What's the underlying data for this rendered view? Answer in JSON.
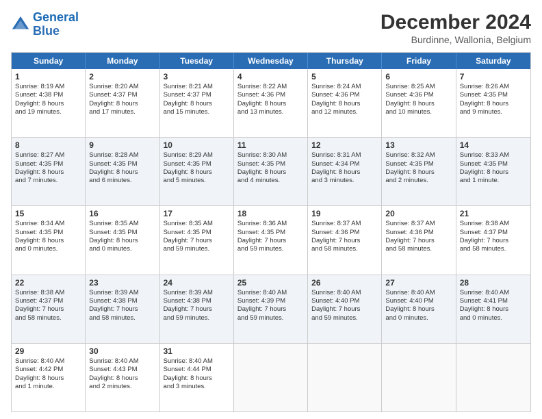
{
  "logo": {
    "line1": "General",
    "line2": "Blue"
  },
  "title": "December 2024",
  "subtitle": "Burdinne, Wallonia, Belgium",
  "header_days": [
    "Sunday",
    "Monday",
    "Tuesday",
    "Wednesday",
    "Thursday",
    "Friday",
    "Saturday"
  ],
  "rows": [
    {
      "alt": false,
      "cells": [
        {
          "day": "1",
          "lines": [
            "Sunrise: 8:19 AM",
            "Sunset: 4:38 PM",
            "Daylight: 8 hours",
            "and 19 minutes."
          ]
        },
        {
          "day": "2",
          "lines": [
            "Sunrise: 8:20 AM",
            "Sunset: 4:37 PM",
            "Daylight: 8 hours",
            "and 17 minutes."
          ]
        },
        {
          "day": "3",
          "lines": [
            "Sunrise: 8:21 AM",
            "Sunset: 4:37 PM",
            "Daylight: 8 hours",
            "and 15 minutes."
          ]
        },
        {
          "day": "4",
          "lines": [
            "Sunrise: 8:22 AM",
            "Sunset: 4:36 PM",
            "Daylight: 8 hours",
            "and 13 minutes."
          ]
        },
        {
          "day": "5",
          "lines": [
            "Sunrise: 8:24 AM",
            "Sunset: 4:36 PM",
            "Daylight: 8 hours",
            "and 12 minutes."
          ]
        },
        {
          "day": "6",
          "lines": [
            "Sunrise: 8:25 AM",
            "Sunset: 4:36 PM",
            "Daylight: 8 hours",
            "and 10 minutes."
          ]
        },
        {
          "day": "7",
          "lines": [
            "Sunrise: 8:26 AM",
            "Sunset: 4:35 PM",
            "Daylight: 8 hours",
            "and 9 minutes."
          ]
        }
      ]
    },
    {
      "alt": true,
      "cells": [
        {
          "day": "8",
          "lines": [
            "Sunrise: 8:27 AM",
            "Sunset: 4:35 PM",
            "Daylight: 8 hours",
            "and 7 minutes."
          ]
        },
        {
          "day": "9",
          "lines": [
            "Sunrise: 8:28 AM",
            "Sunset: 4:35 PM",
            "Daylight: 8 hours",
            "and 6 minutes."
          ]
        },
        {
          "day": "10",
          "lines": [
            "Sunrise: 8:29 AM",
            "Sunset: 4:35 PM",
            "Daylight: 8 hours",
            "and 5 minutes."
          ]
        },
        {
          "day": "11",
          "lines": [
            "Sunrise: 8:30 AM",
            "Sunset: 4:35 PM",
            "Daylight: 8 hours",
            "and 4 minutes."
          ]
        },
        {
          "day": "12",
          "lines": [
            "Sunrise: 8:31 AM",
            "Sunset: 4:34 PM",
            "Daylight: 8 hours",
            "and 3 minutes."
          ]
        },
        {
          "day": "13",
          "lines": [
            "Sunrise: 8:32 AM",
            "Sunset: 4:35 PM",
            "Daylight: 8 hours",
            "and 2 minutes."
          ]
        },
        {
          "day": "14",
          "lines": [
            "Sunrise: 8:33 AM",
            "Sunset: 4:35 PM",
            "Daylight: 8 hours",
            "and 1 minute."
          ]
        }
      ]
    },
    {
      "alt": false,
      "cells": [
        {
          "day": "15",
          "lines": [
            "Sunrise: 8:34 AM",
            "Sunset: 4:35 PM",
            "Daylight: 8 hours",
            "and 0 minutes."
          ]
        },
        {
          "day": "16",
          "lines": [
            "Sunrise: 8:35 AM",
            "Sunset: 4:35 PM",
            "Daylight: 8 hours",
            "and 0 minutes."
          ]
        },
        {
          "day": "17",
          "lines": [
            "Sunrise: 8:35 AM",
            "Sunset: 4:35 PM",
            "Daylight: 7 hours",
            "and 59 minutes."
          ]
        },
        {
          "day": "18",
          "lines": [
            "Sunrise: 8:36 AM",
            "Sunset: 4:35 PM",
            "Daylight: 7 hours",
            "and 59 minutes."
          ]
        },
        {
          "day": "19",
          "lines": [
            "Sunrise: 8:37 AM",
            "Sunset: 4:36 PM",
            "Daylight: 7 hours",
            "and 58 minutes."
          ]
        },
        {
          "day": "20",
          "lines": [
            "Sunrise: 8:37 AM",
            "Sunset: 4:36 PM",
            "Daylight: 7 hours",
            "and 58 minutes."
          ]
        },
        {
          "day": "21",
          "lines": [
            "Sunrise: 8:38 AM",
            "Sunset: 4:37 PM",
            "Daylight: 7 hours",
            "and 58 minutes."
          ]
        }
      ]
    },
    {
      "alt": true,
      "cells": [
        {
          "day": "22",
          "lines": [
            "Sunrise: 8:38 AM",
            "Sunset: 4:37 PM",
            "Daylight: 7 hours",
            "and 58 minutes."
          ]
        },
        {
          "day": "23",
          "lines": [
            "Sunrise: 8:39 AM",
            "Sunset: 4:38 PM",
            "Daylight: 7 hours",
            "and 58 minutes."
          ]
        },
        {
          "day": "24",
          "lines": [
            "Sunrise: 8:39 AM",
            "Sunset: 4:38 PM",
            "Daylight: 7 hours",
            "and 59 minutes."
          ]
        },
        {
          "day": "25",
          "lines": [
            "Sunrise: 8:40 AM",
            "Sunset: 4:39 PM",
            "Daylight: 7 hours",
            "and 59 minutes."
          ]
        },
        {
          "day": "26",
          "lines": [
            "Sunrise: 8:40 AM",
            "Sunset: 4:40 PM",
            "Daylight: 7 hours",
            "and 59 minutes."
          ]
        },
        {
          "day": "27",
          "lines": [
            "Sunrise: 8:40 AM",
            "Sunset: 4:40 PM",
            "Daylight: 8 hours",
            "and 0 minutes."
          ]
        },
        {
          "day": "28",
          "lines": [
            "Sunrise: 8:40 AM",
            "Sunset: 4:41 PM",
            "Daylight: 8 hours",
            "and 0 minutes."
          ]
        }
      ]
    },
    {
      "alt": false,
      "cells": [
        {
          "day": "29",
          "lines": [
            "Sunrise: 8:40 AM",
            "Sunset: 4:42 PM",
            "Daylight: 8 hours",
            "and 1 minute."
          ]
        },
        {
          "day": "30",
          "lines": [
            "Sunrise: 8:40 AM",
            "Sunset: 4:43 PM",
            "Daylight: 8 hours",
            "and 2 minutes."
          ]
        },
        {
          "day": "31",
          "lines": [
            "Sunrise: 8:40 AM",
            "Sunset: 4:44 PM",
            "Daylight: 8 hours",
            "and 3 minutes."
          ]
        },
        {
          "day": "",
          "lines": []
        },
        {
          "day": "",
          "lines": []
        },
        {
          "day": "",
          "lines": []
        },
        {
          "day": "",
          "lines": []
        }
      ]
    }
  ]
}
